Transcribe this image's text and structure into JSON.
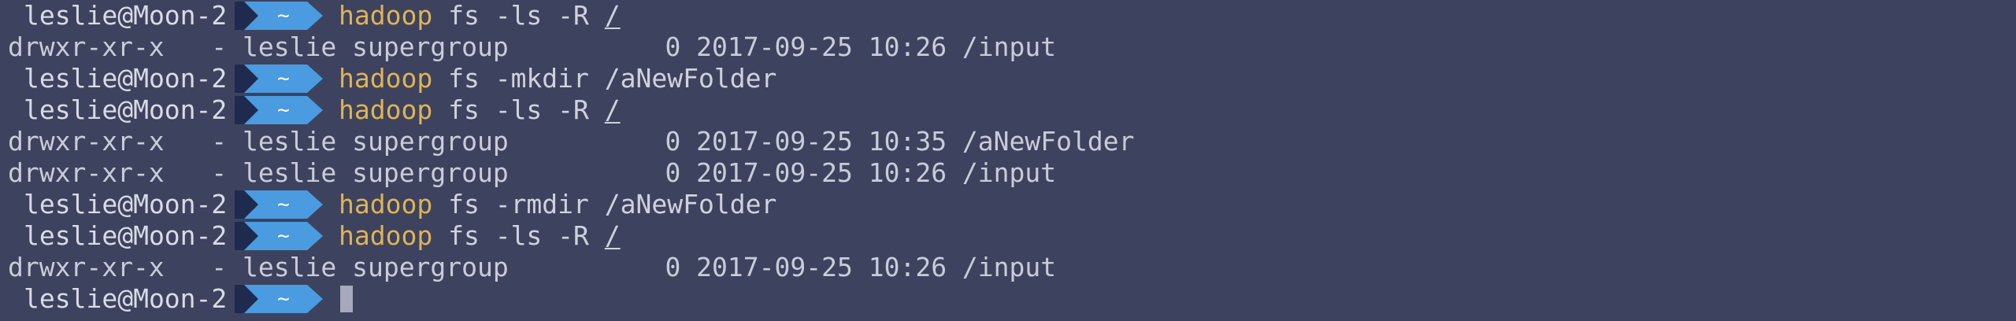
{
  "terminal": {
    "colors": {
      "background": "#3d435e",
      "command_keyword": "#e0b354",
      "segment_dark": "#1f2a4f",
      "segment_blue": "#4a9be0",
      "text": "#c9ccd9"
    },
    "lines": [
      {
        "kind": "prompt",
        "user": "leslie@Moon-2",
        "dir": "~",
        "keyword": "hadoop",
        "args": "fs -ls -R ",
        "path": "/"
      },
      {
        "kind": "output",
        "text": "drwxr-xr-x   - leslie supergroup          0 2017-09-25 10:26 /input"
      },
      {
        "kind": "prompt",
        "user": "leslie@Moon-2",
        "dir": "~",
        "keyword": "hadoop",
        "args": "fs -mkdir /aNewFolder",
        "path": ""
      },
      {
        "kind": "prompt",
        "user": "leslie@Moon-2",
        "dir": "~",
        "keyword": "hadoop",
        "args": "fs -ls -R ",
        "path": "/"
      },
      {
        "kind": "output",
        "text": "drwxr-xr-x   - leslie supergroup          0 2017-09-25 10:35 /aNewFolder"
      },
      {
        "kind": "output",
        "text": "drwxr-xr-x   - leslie supergroup          0 2017-09-25 10:26 /input"
      },
      {
        "kind": "prompt",
        "user": "leslie@Moon-2",
        "dir": "~",
        "keyword": "hadoop",
        "args": "fs -rmdir /aNewFolder",
        "path": ""
      },
      {
        "kind": "prompt",
        "user": "leslie@Moon-2",
        "dir": "~",
        "keyword": "hadoop",
        "args": "fs -ls -R ",
        "path": "/"
      },
      {
        "kind": "output",
        "text": "drwxr-xr-x   - leslie supergroup          0 2017-09-25 10:26 /input"
      },
      {
        "kind": "prompt-active",
        "user": "leslie@Moon-2",
        "dir": "~",
        "keyword": "",
        "args": "",
        "path": ""
      }
    ]
  }
}
